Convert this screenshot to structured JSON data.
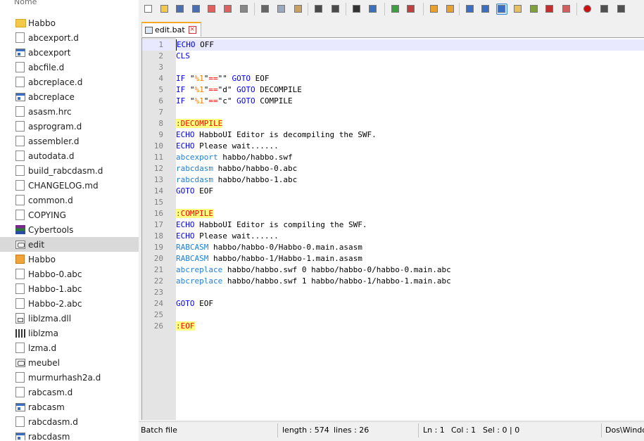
{
  "explorer": {
    "column_header": "Nome",
    "files": [
      {
        "name": "Habbo",
        "icon": "folder-icon",
        "kind": "folder"
      },
      {
        "name": "abcexport.d",
        "icon": "document-icon",
        "kind": "doc"
      },
      {
        "name": "abcexport",
        "icon": "application-icon",
        "kind": "exe"
      },
      {
        "name": "abcfile.d",
        "icon": "document-icon",
        "kind": "doc"
      },
      {
        "name": "abcreplace.d",
        "icon": "document-icon",
        "kind": "doc"
      },
      {
        "name": "abcreplace",
        "icon": "application-icon",
        "kind": "exe"
      },
      {
        "name": "asasm.hrc",
        "icon": "document-icon",
        "kind": "doc"
      },
      {
        "name": "asprogram.d",
        "icon": "document-icon",
        "kind": "doc"
      },
      {
        "name": "assembler.d",
        "icon": "document-icon",
        "kind": "doc"
      },
      {
        "name": "autodata.d",
        "icon": "document-icon",
        "kind": "doc"
      },
      {
        "name": "build_rabcdasm.d",
        "icon": "document-icon",
        "kind": "doc"
      },
      {
        "name": "CHANGELOG.md",
        "icon": "document-icon",
        "kind": "doc"
      },
      {
        "name": "common.d",
        "icon": "document-icon",
        "kind": "doc"
      },
      {
        "name": "COPYING",
        "icon": "document-icon",
        "kind": "doc"
      },
      {
        "name": "Cybertools",
        "icon": "archive-icon",
        "kind": "rar"
      },
      {
        "name": "edit",
        "icon": "batch-file-icon",
        "kind": "bat",
        "selected": true
      },
      {
        "name": "Habbo",
        "icon": "habbo-icon",
        "kind": "habbo"
      },
      {
        "name": "Habbo-0.abc",
        "icon": "document-icon",
        "kind": "doc"
      },
      {
        "name": "Habbo-1.abc",
        "icon": "document-icon",
        "kind": "doc"
      },
      {
        "name": "Habbo-2.abc",
        "icon": "document-icon",
        "kind": "doc"
      },
      {
        "name": "liblzma.dll",
        "icon": "dll-icon",
        "kind": "dll"
      },
      {
        "name": "liblzma",
        "icon": "library-icon",
        "kind": "lib"
      },
      {
        "name": "lzma.d",
        "icon": "document-icon",
        "kind": "doc"
      },
      {
        "name": "meubel",
        "icon": "batch-file-icon",
        "kind": "bat"
      },
      {
        "name": "murmurhash2a.d",
        "icon": "document-icon",
        "kind": "doc"
      },
      {
        "name": "rabcasm.d",
        "icon": "document-icon",
        "kind": "doc"
      },
      {
        "name": "rabcasm",
        "icon": "application-icon",
        "kind": "exe"
      },
      {
        "name": "rabcdasm.d",
        "icon": "document-icon",
        "kind": "doc"
      },
      {
        "name": "rabcdasm",
        "icon": "application-icon",
        "kind": "exe"
      }
    ]
  },
  "editor": {
    "toolbar_icons": [
      "new-file-icon",
      "open-file-icon",
      "save-icon",
      "save-all-icon",
      "close-icon",
      "close-all-icon",
      "print-icon",
      "cut-icon",
      "copy-icon",
      "paste-icon",
      "undo-icon",
      "redo-icon",
      "find-icon",
      "replace-icon",
      "zoom-in-icon",
      "zoom-out-icon",
      "sync-vertical-icon",
      "sync-horizontal-icon",
      "word-wrap-icon",
      "show-all-chars-icon",
      "indent-guide-icon",
      "user-language-icon",
      "document-map-icon",
      "function-list-icon",
      "folder-workspace-icon",
      "record-macro-icon",
      "stop-record-icon",
      "playback-macro-icon"
    ],
    "tab": {
      "label": "edit.bat",
      "close_icon": "close-tab-icon"
    },
    "lines": [
      [
        {
          "t": "ECHO",
          "c": "kw"
        },
        {
          "t": " OFF"
        }
      ],
      [
        {
          "t": "CLS",
          "c": "kw"
        }
      ],
      [],
      [
        {
          "t": "IF",
          "c": "kw"
        },
        {
          "t": " \""
        },
        {
          "t": "%1",
          "c": "var"
        },
        {
          "t": "\""
        },
        {
          "t": "==",
          "c": "op"
        },
        {
          "t": "\"\" "
        },
        {
          "t": "GOTO",
          "c": "kw"
        },
        {
          "t": " EOF"
        }
      ],
      [
        {
          "t": "IF",
          "c": "kw"
        },
        {
          "t": " \""
        },
        {
          "t": "%1",
          "c": "var"
        },
        {
          "t": "\""
        },
        {
          "t": "==",
          "c": "op"
        },
        {
          "t": "\"d\" "
        },
        {
          "t": "GOTO",
          "c": "kw"
        },
        {
          "t": " DECOMPILE"
        }
      ],
      [
        {
          "t": "IF",
          "c": "kw"
        },
        {
          "t": " \""
        },
        {
          "t": "%1",
          "c": "var"
        },
        {
          "t": "\""
        },
        {
          "t": "==",
          "c": "op"
        },
        {
          "t": "\"c\" "
        },
        {
          "t": "GOTO",
          "c": "kw"
        },
        {
          "t": " COMPILE"
        }
      ],
      [],
      [
        {
          "t": ":DECOMPILE",
          "c": "lbl"
        }
      ],
      [
        {
          "t": "ECHO",
          "c": "kw"
        },
        {
          "t": " HabboUI Editor is decompiling the SWF."
        }
      ],
      [
        {
          "t": "ECHO",
          "c": "kw"
        },
        {
          "t": " Please wait......"
        }
      ],
      [
        {
          "t": "abcexport",
          "c": "ext"
        },
        {
          "t": " habbo/habbo.swf"
        }
      ],
      [
        {
          "t": "rabcdasm",
          "c": "ext"
        },
        {
          "t": " habbo/habbo-0.abc"
        }
      ],
      [
        {
          "t": "rabcdasm",
          "c": "ext"
        },
        {
          "t": " habbo/habbo-1.abc"
        }
      ],
      [
        {
          "t": "GOTO",
          "c": "kw"
        },
        {
          "t": " EOF"
        }
      ],
      [],
      [
        {
          "t": ":COMPILE",
          "c": "lbl"
        }
      ],
      [
        {
          "t": "ECHO",
          "c": "kw"
        },
        {
          "t": " HabboUI Editor is compiling the SWF."
        }
      ],
      [
        {
          "t": "ECHO",
          "c": "kw"
        },
        {
          "t": " Please wait......"
        }
      ],
      [
        {
          "t": "RABCASM",
          "c": "ext"
        },
        {
          "t": " habbo/habbo-0/Habbo-0.main.asasm"
        }
      ],
      [
        {
          "t": "RABCASM",
          "c": "ext"
        },
        {
          "t": " habbo/habbo-1/Habbo-1.main.asasm"
        }
      ],
      [
        {
          "t": "abcreplace",
          "c": "ext"
        },
        {
          "t": " habbo/habbo.swf 0 habbo/habbo-0/habbo-0.main.abc"
        }
      ],
      [
        {
          "t": "abcreplace",
          "c": "ext"
        },
        {
          "t": " habbo/habbo.swf 1 habbo/habbo-1/habbo-1.main.abc"
        }
      ],
      [],
      [
        {
          "t": "GOTO",
          "c": "kw"
        },
        {
          "t": " EOF"
        }
      ],
      [],
      [
        {
          "t": ":EOF",
          "c": "lbl"
        }
      ]
    ],
    "status": {
      "language": "Batch file",
      "length": "length : 574",
      "lines": "lines : 26",
      "ln": "Ln : 1",
      "col": "Col : 1",
      "sel": "Sel : 0 | 0",
      "eol": "Dos\\Windows"
    }
  }
}
